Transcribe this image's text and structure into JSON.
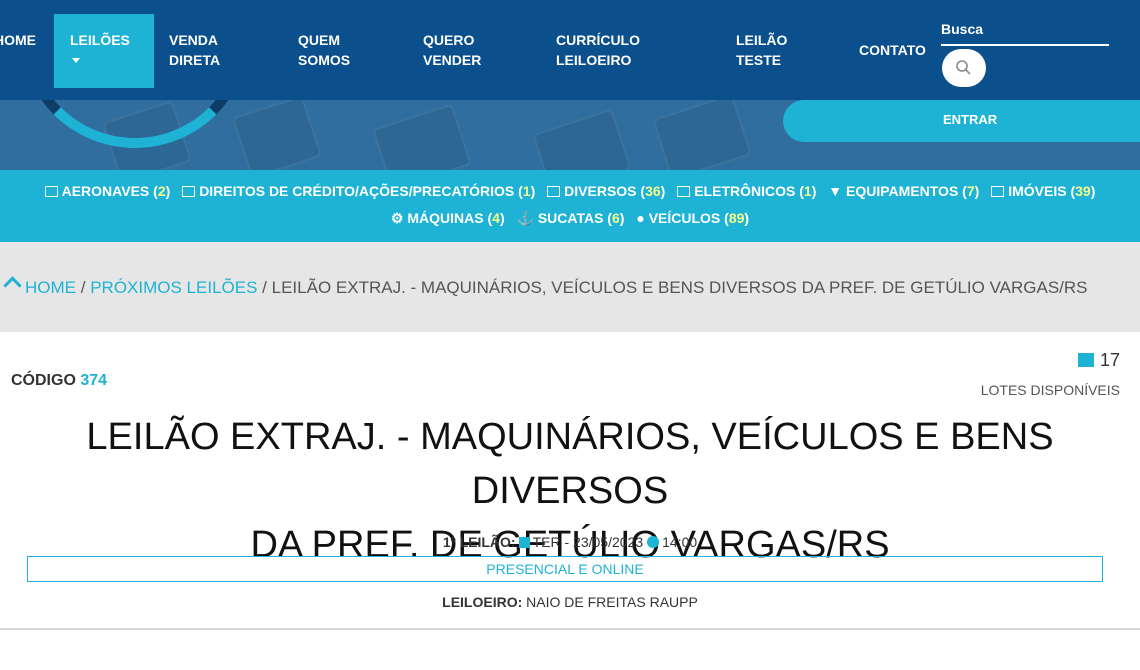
{
  "nav": {
    "items": [
      {
        "line1": "HOME",
        "line2": ""
      },
      {
        "line1": "LEILÕES",
        "line2": ""
      },
      {
        "line1": "VENDA",
        "line2": "DIRETA"
      },
      {
        "line1": "QUEM",
        "line2": "SOMOS"
      },
      {
        "line1": "QUERO",
        "line2": "VENDER"
      },
      {
        "line1": "CURRÍCULO",
        "line2": "LEILOEIRO"
      },
      {
        "line1": "LEILÃO",
        "line2": "TESTE"
      },
      {
        "line1": "CONTATO",
        "line2": ""
      }
    ],
    "search_label": "Busca",
    "search_icon": "search-icon",
    "login_label": "ENTRAR"
  },
  "categories": [
    {
      "label": "AERONAVES",
      "count": "2",
      "icon": "list-icon"
    },
    {
      "label": "DIREITOS DE CRÉDITO/AÇÕES/PRECATÓRIOS",
      "count": "1",
      "icon": "list-icon"
    },
    {
      "label": "DIVERSOS",
      "count": "36",
      "icon": "laptop-icon"
    },
    {
      "label": "ELETRÔNICOS",
      "count": "1",
      "icon": "monitor-icon"
    },
    {
      "label": "EQUIPAMENTOS",
      "count": "7",
      "icon": "plug-icon"
    },
    {
      "label": "IMÓVEIS",
      "count": "39",
      "icon": "building-icon"
    },
    {
      "label": "MÁQUINAS",
      "count": "4",
      "icon": "tractor-icon"
    },
    {
      "label": "SUCATAS",
      "count": "6",
      "icon": "ship-icon"
    },
    {
      "label": "VEÍCULOS",
      "count": "89",
      "icon": "car-icon"
    }
  ],
  "breadcrumb": {
    "home": "HOME",
    "section": "PRÓXIMOS LEILÕES",
    "current": "LEILÃO EXTRAJ. - MAQUINÁRIOS, VEÍCULOS E BENS DIVERSOS DA PREF. DE GETÚLIO VARGAS/RS",
    "separator": "/"
  },
  "auction": {
    "code_label": "CÓDIGO",
    "code_value": "374",
    "lots_count": "17",
    "lots_label": "LOTES DISPONÍVEIS",
    "title_line1": "LEILÃO EXTRAJ. - MAQUINÁRIOS, VEÍCULOS E BENS DIVERSOS",
    "title_line2": "DA PREF. DE GETÚLIO VARGAS/RS",
    "first_label": "1º LEILÃO:",
    "first_date": "TER - 23/05/2023",
    "first_time": "14:00",
    "mode": "PRESENCIAL E ONLINE",
    "auctioneer_label": "LEILOEIRO:",
    "auctioneer_name": "NAIO DE FREITAS RAUPP"
  },
  "colors": {
    "nav_bg": "#0b4f8c",
    "accent": "#1eb3d4",
    "count_highlight": "#f4ff8a"
  }
}
